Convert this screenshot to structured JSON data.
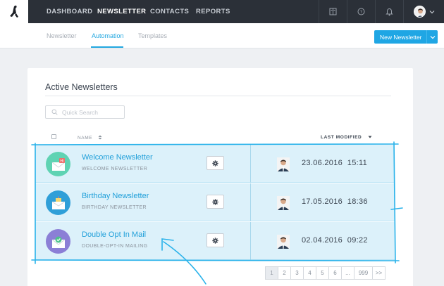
{
  "nav": {
    "items": [
      {
        "label": "DASHBOARD",
        "active": false
      },
      {
        "label": "NEWSLETTER",
        "active": true
      },
      {
        "label": "CONTACTS",
        "active": false
      },
      {
        "label": "REPORTS",
        "active": false
      }
    ],
    "icons": [
      "book-icon",
      "help-icon",
      "bell-icon"
    ]
  },
  "subnav": {
    "tabs": [
      {
        "label": "Newsletter",
        "active": false
      },
      {
        "label": "Automation",
        "active": true
      },
      {
        "label": "Templates",
        "active": false
      }
    ],
    "new_button": "New Newsletter"
  },
  "card": {
    "title": "Active Newsletters",
    "search_placeholder": "Quick Search",
    "col_name": "NAME",
    "col_modified": "LAST MODIFIED"
  },
  "rows": [
    {
      "name": "Welcome Newsletter",
      "subtitle": "WELCOME NEWSLETTER",
      "date": "23.06.2016",
      "time": "15:11",
      "icon": "welcome-envelope-icon",
      "icon_color": "#5fd3b3"
    },
    {
      "name": "Birthday Newsletter",
      "subtitle": "BIRTHDAY NEWSLETTER",
      "date": "17.05.2016",
      "time": "18:36",
      "icon": "birthday-envelope-icon",
      "icon_color": "#2f9fd8"
    },
    {
      "name": "Double Opt In Mail",
      "subtitle": "DOUBLE-OPT-IN MAILING",
      "date": "02.04.2016",
      "time": "09:22",
      "icon": "check-envelope-icon",
      "icon_color": "#8b7fd6"
    }
  ],
  "pagination": [
    "1",
    "2",
    "3",
    "4",
    "5",
    "6",
    "...",
    "999",
    ">>"
  ],
  "colors": {
    "accent": "#22a7e0",
    "nav_bg": "#2b3038",
    "row_highlight": "#dcf1fa"
  }
}
